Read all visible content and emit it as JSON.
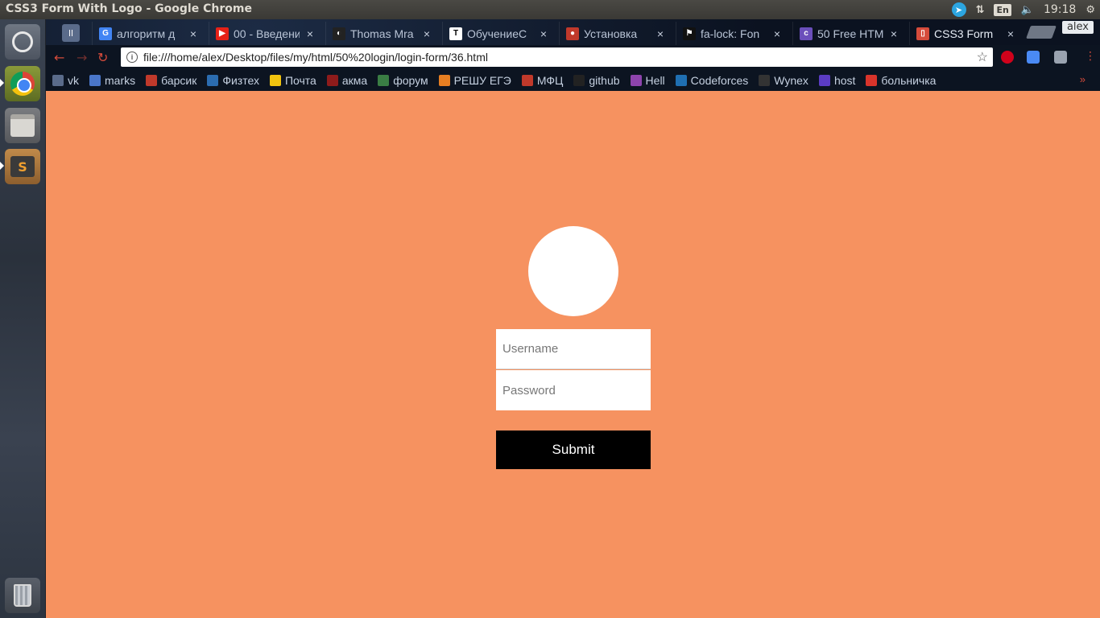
{
  "window": {
    "title": "CSS3 Form With Logo - Google Chrome"
  },
  "panel": {
    "keyboard_layout": "En",
    "clock": "19:18",
    "icons": [
      "telegram-icon",
      "network-icon",
      "volume-icon",
      "settings-gear-icon"
    ]
  },
  "launcher": {
    "items": [
      "dash-icon",
      "chrome-icon",
      "files-icon",
      "sublime-text-icon",
      "trash-icon"
    ]
  },
  "tabs": [
    {
      "label": "алгоритм д",
      "favicon_color": "#4285f4",
      "favicon_text": "G"
    },
    {
      "label": "00 - Введени",
      "favicon_color": "#e62117",
      "favicon_text": "▶"
    },
    {
      "label": "Thomas Mra",
      "favicon_color": "#222222",
      "favicon_text": "◐"
    },
    {
      "label": "ОбучениеС",
      "favicon_color": "#ffffff",
      "favicon_text": "T"
    },
    {
      "label": "Установка",
      "favicon_color": "#c0392b",
      "favicon_text": "●"
    },
    {
      "label": "fa-lock: Fon",
      "favicon_color": "#111111",
      "favicon_text": "⚑"
    },
    {
      "label": "50 Free HTM",
      "favicon_color": "#6b4fbb",
      "favicon_text": "c"
    },
    {
      "label": "CSS3 Form",
      "favicon_color": "#d54b3b",
      "favicon_text": "▯"
    }
  ],
  "profile_name": "alex",
  "omnibox": {
    "url": "file:///home/alex/Desktop/files/my/html/50%20login/login-form/36.html"
  },
  "bookmarks": [
    {
      "label": "vk",
      "color": "#5a6b8a"
    },
    {
      "label": "marks",
      "color": "#4a76c9"
    },
    {
      "label": "барсик",
      "color": "#c0392b"
    },
    {
      "label": "Физтех",
      "color": "#2b6cb0"
    },
    {
      "label": "Почта",
      "color": "#f1c40f"
    },
    {
      "label": "акма",
      "color": "#8e1b1b"
    },
    {
      "label": "форум",
      "color": "#3a7d44"
    },
    {
      "label": "РЕШУ ЕГЭ",
      "color": "#e67e22"
    },
    {
      "label": "МФЦ",
      "color": "#c0392b"
    },
    {
      "label": "github",
      "color": "#222222"
    },
    {
      "label": "Hell",
      "color": "#8e44ad"
    },
    {
      "label": "Codeforces",
      "color": "#1f6fb2"
    },
    {
      "label": "Wynex",
      "color": "#333333"
    },
    {
      "label": "host",
      "color": "#5b3cc4"
    },
    {
      "label": "больничка",
      "color": "#d9342b"
    }
  ],
  "form": {
    "username_placeholder": "Username",
    "password_placeholder": "Password",
    "submit_label": "Submit"
  },
  "colors": {
    "page_background": "#f69260",
    "submit_background": "#000000",
    "logo_fill": "#ffffff"
  }
}
